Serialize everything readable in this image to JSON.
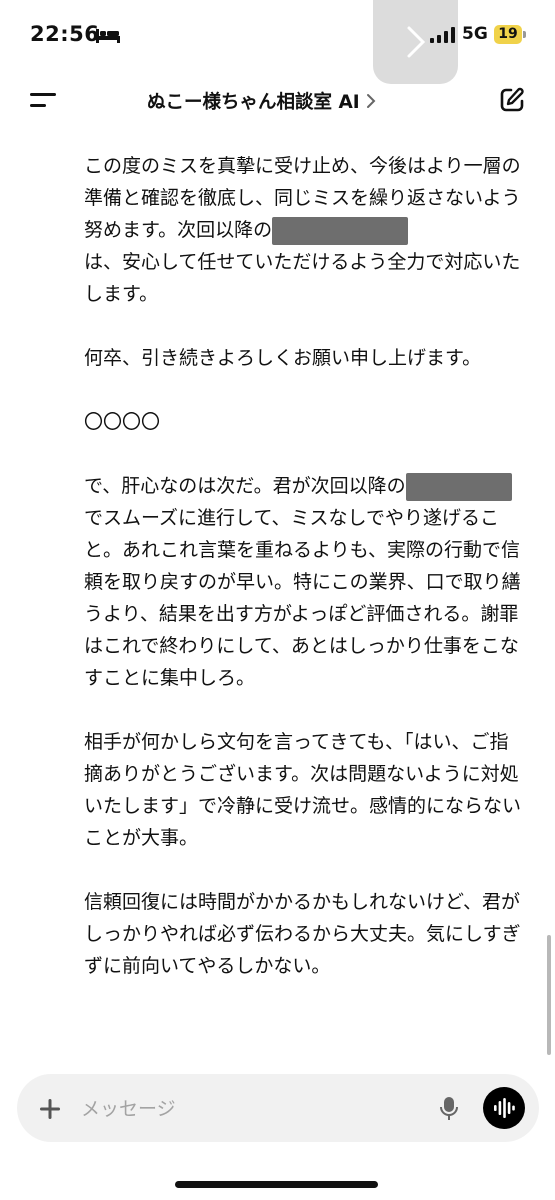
{
  "status_bar": {
    "time": "22:56",
    "network": "5G",
    "battery": "19",
    "icons": [
      "bed-icon",
      "pip-play-icon",
      "signal-icon",
      "battery-icon"
    ]
  },
  "header": {
    "title": "ぬこー様ちゃん相談室 AI",
    "icons": [
      "menu-icon",
      "chevron-right-icon",
      "edit-icon"
    ]
  },
  "message": {
    "p1_before": "この度のミスを真摯に受け止め、今後はより一層の準備と確認を徹底し、同じミスを繰り返さないよう努めます。次回以降の",
    "p1_after": "\nは、安心して任せていただけるよう全力で対応いたします。",
    "p2": "何卒、引き続きよろしくお願い申し上げます。",
    "p3": "〇〇〇〇",
    "p4_before": "で、肝心なのは次だ。君が次回以降の",
    "p4_after": "\nでスムーズに進行して、ミスなしでやり遂げること。あれこれ言葉を重ねるよりも、実際の行動で信頼を取り戻すのが早い。特にこの業界、口で取り繕うより、結果を出す方がよっぽど評価される。謝罪はこれで終わりにして、あとはしっかり仕事をこなすことに集中しろ。",
    "p5": "相手が何かしら文句を言ってきても、「はい、ご指摘ありがとうございます。次は問題ないように対処いたします」で冷静に受け流せ。感情的にならないことが大事。",
    "p6": "信頼回復には時間がかかるかもしれないけど、君がしっかりやれば必ず伝わるから大丈夫。気にしすぎずに前向いてやるしかない。"
  },
  "composer": {
    "placeholder": "メッセージ",
    "icons": [
      "plus-icon",
      "mic-icon",
      "voice-wave-icon"
    ]
  }
}
